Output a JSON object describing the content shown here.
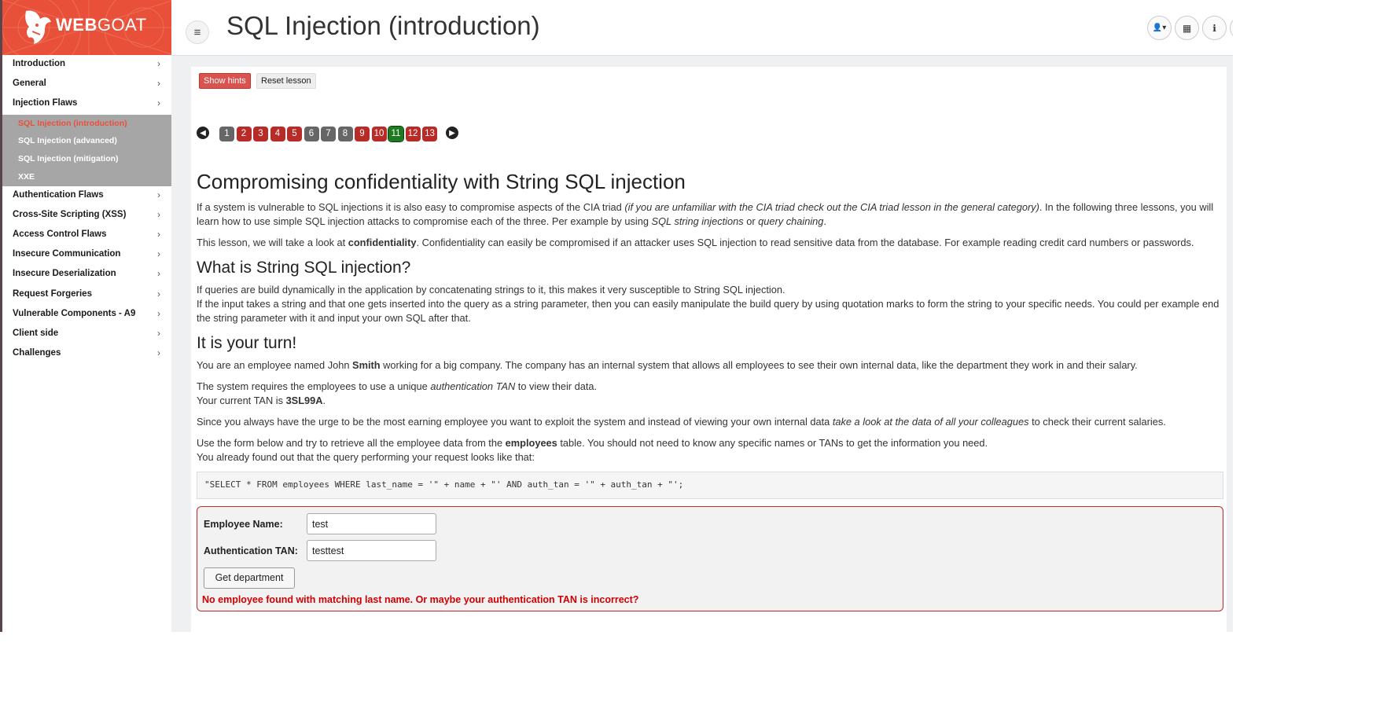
{
  "brand": {
    "bold": "WEB",
    "light": "GOAT"
  },
  "sidebar": {
    "items": [
      {
        "label": "Introduction"
      },
      {
        "label": "General"
      },
      {
        "label": "Injection Flaws"
      },
      {
        "label": "Authentication Flaws"
      },
      {
        "label": "Cross-Site Scripting (XSS)"
      },
      {
        "label": "Access Control Flaws"
      },
      {
        "label": "Insecure Communication"
      },
      {
        "label": "Insecure Deserialization"
      },
      {
        "label": "Request Forgeries"
      },
      {
        "label": "Vulnerable Components - A9"
      },
      {
        "label": "Client side"
      },
      {
        "label": "Challenges"
      }
    ],
    "submenu": [
      {
        "label": "SQL Injection (introduction)",
        "active": true
      },
      {
        "label": "SQL Injection (advanced)"
      },
      {
        "label": "SQL Injection (mitigation)"
      },
      {
        "label": "XXE"
      }
    ],
    "chevron": "›"
  },
  "header": {
    "title": "SQL Injection (introduction)",
    "toggle_icon": "≡",
    "buttons": [
      {
        "icon": "user-icon",
        "glyph": "👤▾"
      },
      {
        "icon": "chart-icon",
        "glyph": "▦"
      },
      {
        "icon": "info-icon",
        "glyph": "ℹ"
      }
    ]
  },
  "toolbar": {
    "hints_label": "Show hints",
    "reset_label": "Reset lesson"
  },
  "pager": {
    "pages": [
      {
        "label": "1",
        "state": "grey"
      },
      {
        "label": "2",
        "state": "red"
      },
      {
        "label": "3",
        "state": "red"
      },
      {
        "label": "4",
        "state": "red"
      },
      {
        "label": "5",
        "state": "red"
      },
      {
        "label": "6",
        "state": "grey"
      },
      {
        "label": "7",
        "state": "grey"
      },
      {
        "label": "8",
        "state": "grey"
      },
      {
        "label": "9",
        "state": "red"
      },
      {
        "label": "10",
        "state": "red"
      },
      {
        "label": "11",
        "state": "green"
      },
      {
        "label": "12",
        "state": "red"
      },
      {
        "label": "13",
        "state": "red"
      }
    ],
    "prev_glyph": "◀",
    "next_glyph": "▶"
  },
  "lesson": {
    "heading": "Compromising confidentiality with String SQL injection",
    "p1": {
      "a": "If a system is vulnerable to SQL injections it is also easy to compromise aspects of the CIA triad ",
      "b": "(if you are unfamiliar with the CIA triad check out the CIA triad lesson in the general category)",
      "c": ". In the following three lessons, you will learn how to use simple SQL injection attacks to compromise each of the three. Per example by using ",
      "d": "SQL string injections",
      "e": " or ",
      "f": "query chaining",
      "g": "."
    },
    "p2": {
      "a": "This lesson, we will take a look at ",
      "b": "confidentiality",
      "c": ". Confidentiality can easily be compromised if an attacker uses SQL injection to read sensitive data from the database. For example reading credit card numbers or passwords."
    },
    "h_what": "What is String SQL injection?",
    "p3": {
      "a": "If queries are build dynamically in the application by concatenating strings to it, this makes it very susceptible to String SQL injection.",
      "b": "If the input takes a string and that one gets inserted into the query as a string parameter, then you can easily manipulate the build query by using quotation marks to form the string to your specific needs. You could per example end the string parameter with it and input your own SQL after that."
    },
    "h_turn": "It is your turn!",
    "p4": {
      "a": "You are an employee named John ",
      "b": "Smith",
      "c": " working for a big company. The company has an internal system that allows all employees to see their own internal data, like the department they work in and their salary."
    },
    "p5": {
      "a": "The system requires the employees to use a unique ",
      "b": "authentication TAN",
      "c": " to view their data.",
      "d": "Your current TAN is ",
      "e": "3SL99A",
      "f": "."
    },
    "p6": {
      "a": "Since you always have the urge to be the most earning employee you want to exploit the system and instead of viewing your own internal data ",
      "b": "take a look at the data of all your colleagues",
      "c": " to check their current salaries."
    },
    "p7": {
      "a": "Use the form below and try to retrieve all the employee data from the ",
      "b": "employees",
      "c": " table. You should not need to know any specific names or TANs to get the information you need.",
      "d": "You already found out that the query performing your request looks like that:"
    },
    "code": "\"SELECT * FROM employees WHERE last_name = '\" + name + \"' AND auth_tan = '\" + auth_tan + \"';"
  },
  "form": {
    "name_label": "Employee Name:",
    "name_value": "test",
    "tan_label": "Authentication TAN:",
    "tan_value": "testtest",
    "submit_label": "Get department",
    "error": "No employee found with matching last name. Or maybe your authentication TAN is incorrect?"
  },
  "colors": {
    "brand": "#e8503a",
    "danger": "#b92b27",
    "success": "#1e7a1e",
    "submenu_bg": "#a6a6a6"
  }
}
